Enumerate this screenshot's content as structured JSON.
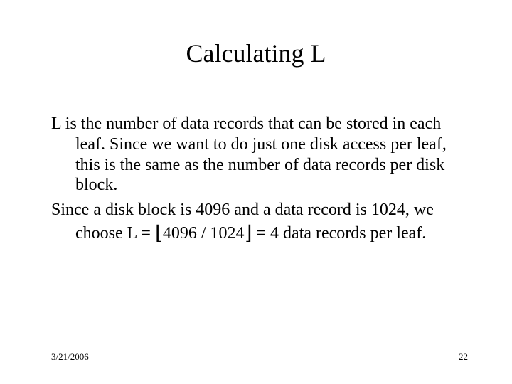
{
  "title": "Calculating L",
  "body": {
    "p1": "L is the number of data records that can be stored in each leaf.  Since we want to do just one disk access per leaf, this is the same as the number of data records per disk block.",
    "p2_before": "Since a disk block is 4096 and a data record is 1024, we choose L = ",
    "p2_expr": "4096 / 1024",
    "p2_after": " = 4 data records per leaf."
  },
  "footer": {
    "date": "3/21/2006",
    "page": "22"
  }
}
